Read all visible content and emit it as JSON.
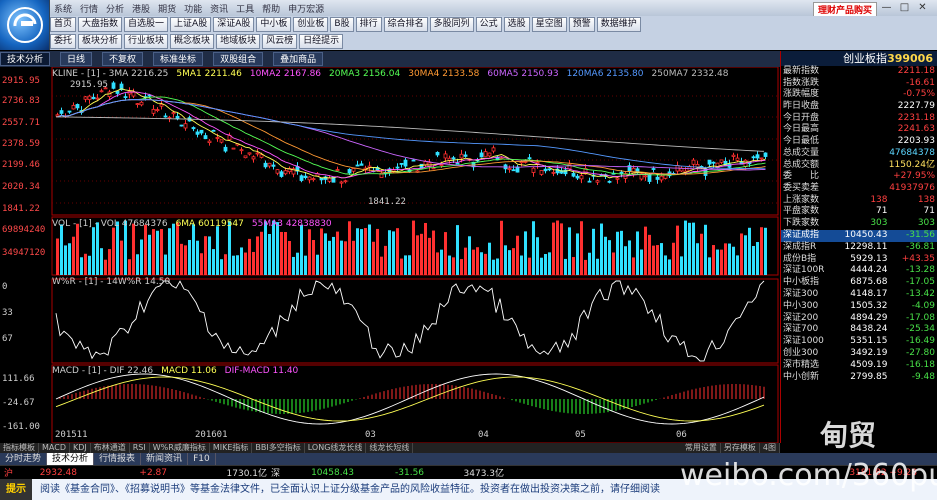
{
  "menu": [
    "系统",
    "行情",
    "分析",
    "港股",
    "期货",
    "功能",
    "资讯",
    "工具",
    "帮助",
    "申万宏源"
  ],
  "promo": "理财产品购买",
  "toolbar1": [
    "首页",
    "大盘指数",
    "自选股一",
    "上证A股",
    "深证A股",
    "中小板",
    "创业板",
    "B股",
    "排行",
    "综合排名",
    "多股同列",
    "公式",
    "选股",
    "星空图",
    "预警",
    "数据维护"
  ],
  "toolbar2": [
    "委托",
    "板块分析",
    "行业板块",
    "概念板块",
    "地域板块",
    "风云榜",
    "日经提示"
  ],
  "tabs": [
    "技术分析",
    "日线",
    "不复权",
    "标准坐标",
    "双股组合",
    "叠加商品"
  ],
  "main_chart": {
    "y_labels": [
      "2915.95",
      "2736.83",
      "2557.71",
      "2378.59",
      "2199.46",
      "2020.34",
      "1841.22"
    ],
    "high_label": "2915.95",
    "low_label": "1841.22",
    "legend": [
      {
        "text": "KLINE - [1] - 3MA 2216.25",
        "color": "#cccccc"
      },
      {
        "text": "5MA1 2211.46",
        "color": "#ffff55"
      },
      {
        "text": "10MA2 2167.86",
        "color": "#ff55ff"
      },
      {
        "text": "20MA3 2156.04",
        "color": "#55ff55"
      },
      {
        "text": "30MA4 2133.58",
        "color": "#ff9933"
      },
      {
        "text": "60MA5 2150.93",
        "color": "#cc66ff"
      },
      {
        "text": "120MA6 2135.80",
        "color": "#5599ff"
      },
      {
        "text": "250MA7 2332.48",
        "color": "#bbbbbb"
      }
    ]
  },
  "vol_chart": {
    "y_labels": [
      "69894240",
      "34947120"
    ],
    "legend": [
      {
        "text": "VOL - [1] - VOL 47684376",
        "color": "#cccccc"
      },
      {
        "text": "6MA 60119547",
        "color": "#ffff55"
      },
      {
        "text": "55MA3 42838830",
        "color": "#ff55ff"
      }
    ]
  },
  "wr_chart": {
    "y_labels": [
      "0",
      "33",
      "67"
    ],
    "legend": [
      {
        "text": "W%R - [1] - 14W%R 14.50",
        "color": "#cccccc"
      }
    ]
  },
  "macd_chart": {
    "y_labels": [
      "111.66",
      "-24.67",
      "-161.00"
    ],
    "legend": [
      {
        "text": "MACD - [1] - DIF 22.46",
        "color": "#cccccc"
      },
      {
        "text": "MACD 11.06",
        "color": "#ffff55"
      },
      {
        "text": "DIF-MACD 11.40",
        "color": "#ff55ff"
      }
    ]
  },
  "x_labels": [
    "201511",
    "201601",
    "03",
    "04",
    "05",
    "06"
  ],
  "right_panel": {
    "title": "创业板指",
    "code": "399006",
    "stats": [
      {
        "k": "最新指数",
        "v": "2211.18",
        "c": "v"
      },
      {
        "k": "指数涨跌",
        "v": "-16.61",
        "c": "v"
      },
      {
        "k": "涨跌幅度",
        "v": "-0.75%",
        "c": "v"
      },
      {
        "k": "昨日收盘",
        "v": "2227.79",
        "c": "w"
      },
      {
        "k": "今日开盘",
        "v": "2231.18",
        "c": "v"
      },
      {
        "k": "今日最高",
        "v": "2241.63",
        "c": "v"
      },
      {
        "k": "今日最低",
        "v": "2203.93",
        "c": "w"
      },
      {
        "k": "总成交量",
        "v": "47684378",
        "c": "c"
      },
      {
        "k": "总成交额",
        "v": "1150.24亿",
        "c": "y"
      },
      {
        "k": "委　　比",
        "v": "+27.95%",
        "c": "v"
      },
      {
        "k": "委买卖差",
        "v": "41937976",
        "c": "v"
      }
    ],
    "counts": [
      {
        "k": "上涨家数",
        "a": "138",
        "b": "138"
      },
      {
        "k": "平盘家数",
        "a": "71",
        "b": "71"
      },
      {
        "k": "下跌家数",
        "a": "303",
        "b": "303"
      }
    ],
    "indices": [
      {
        "k": "深证成指",
        "a": "10450.43",
        "b": "-31.56",
        "g": false,
        "hl": true
      },
      {
        "k": "深成指R",
        "a": "12298.11",
        "b": "-36.81",
        "g": false,
        "hl": false
      },
      {
        "k": "成份B指",
        "a": "5929.13",
        "b": "+43.35",
        "g": false,
        "hl": false
      },
      {
        "k": "深证100R",
        "a": "4444.24",
        "b": "-13.28",
        "g": false,
        "hl": false
      },
      {
        "k": "中小板指",
        "a": "6875.68",
        "b": "-17.05",
        "g": false,
        "hl": false
      },
      {
        "k": "深证300",
        "a": "4148.17",
        "b": "-13.42",
        "g": false,
        "hl": false
      },
      {
        "k": "中小300",
        "a": "1505.32",
        "b": "-4.09",
        "g": false,
        "hl": false
      },
      {
        "k": "深证200",
        "a": "4894.29",
        "b": "-17.08",
        "g": false,
        "hl": false
      },
      {
        "k": "深证700",
        "a": "8438.24",
        "b": "-25.34",
        "g": false,
        "hl": false
      },
      {
        "k": "深证1000",
        "a": "5351.15",
        "b": "-16.49",
        "g": false,
        "hl": false
      },
      {
        "k": "创业300",
        "a": "3492.19",
        "b": "-27.80",
        "g": false,
        "hl": false
      },
      {
        "k": "深市精选",
        "a": "4509.19",
        "b": "-16.18",
        "g": false,
        "hl": false
      },
      {
        "k": "中小创新",
        "a": "2799.85",
        "b": "-9.48",
        "g": false,
        "hl": false
      }
    ]
  },
  "bottom_tabs": [
    "指标模板",
    "MACD",
    "KDJ",
    "布林通道",
    "RSI",
    "W%R威廉指标",
    "MIKE指标",
    "BBI多空指标",
    "LONG线龙长线",
    "线龙长短线"
  ],
  "bottom_tabs_right": [
    "常用设置",
    "另存模板",
    "4图"
  ],
  "bottom_nav": [
    "分时走势",
    "技术分析",
    "行情报表",
    "新闻资讯",
    "F10"
  ],
  "status": {
    "sh_label": "沪",
    "sh_value": "2932.48",
    "sh_change": "+2.87",
    "sh_amount": "1730.1亿",
    "sz_label": "深",
    "sz_value": "10458.43",
    "sz_change": "-31.56",
    "sz_amount": "3473.3亿",
    "right": "3181.82 +9.28"
  },
  "ticker": {
    "label": "提示",
    "text": "阅读《基金合同》、《招募说明书》等基金法律文件，已全面认识上证分级基金产品的风险收益特征。投资者在做出投资决策之前，请仔细阅读"
  },
  "watermark": {
    "logo": "甸贸",
    "url": "weibo.com/360puer"
  }
}
